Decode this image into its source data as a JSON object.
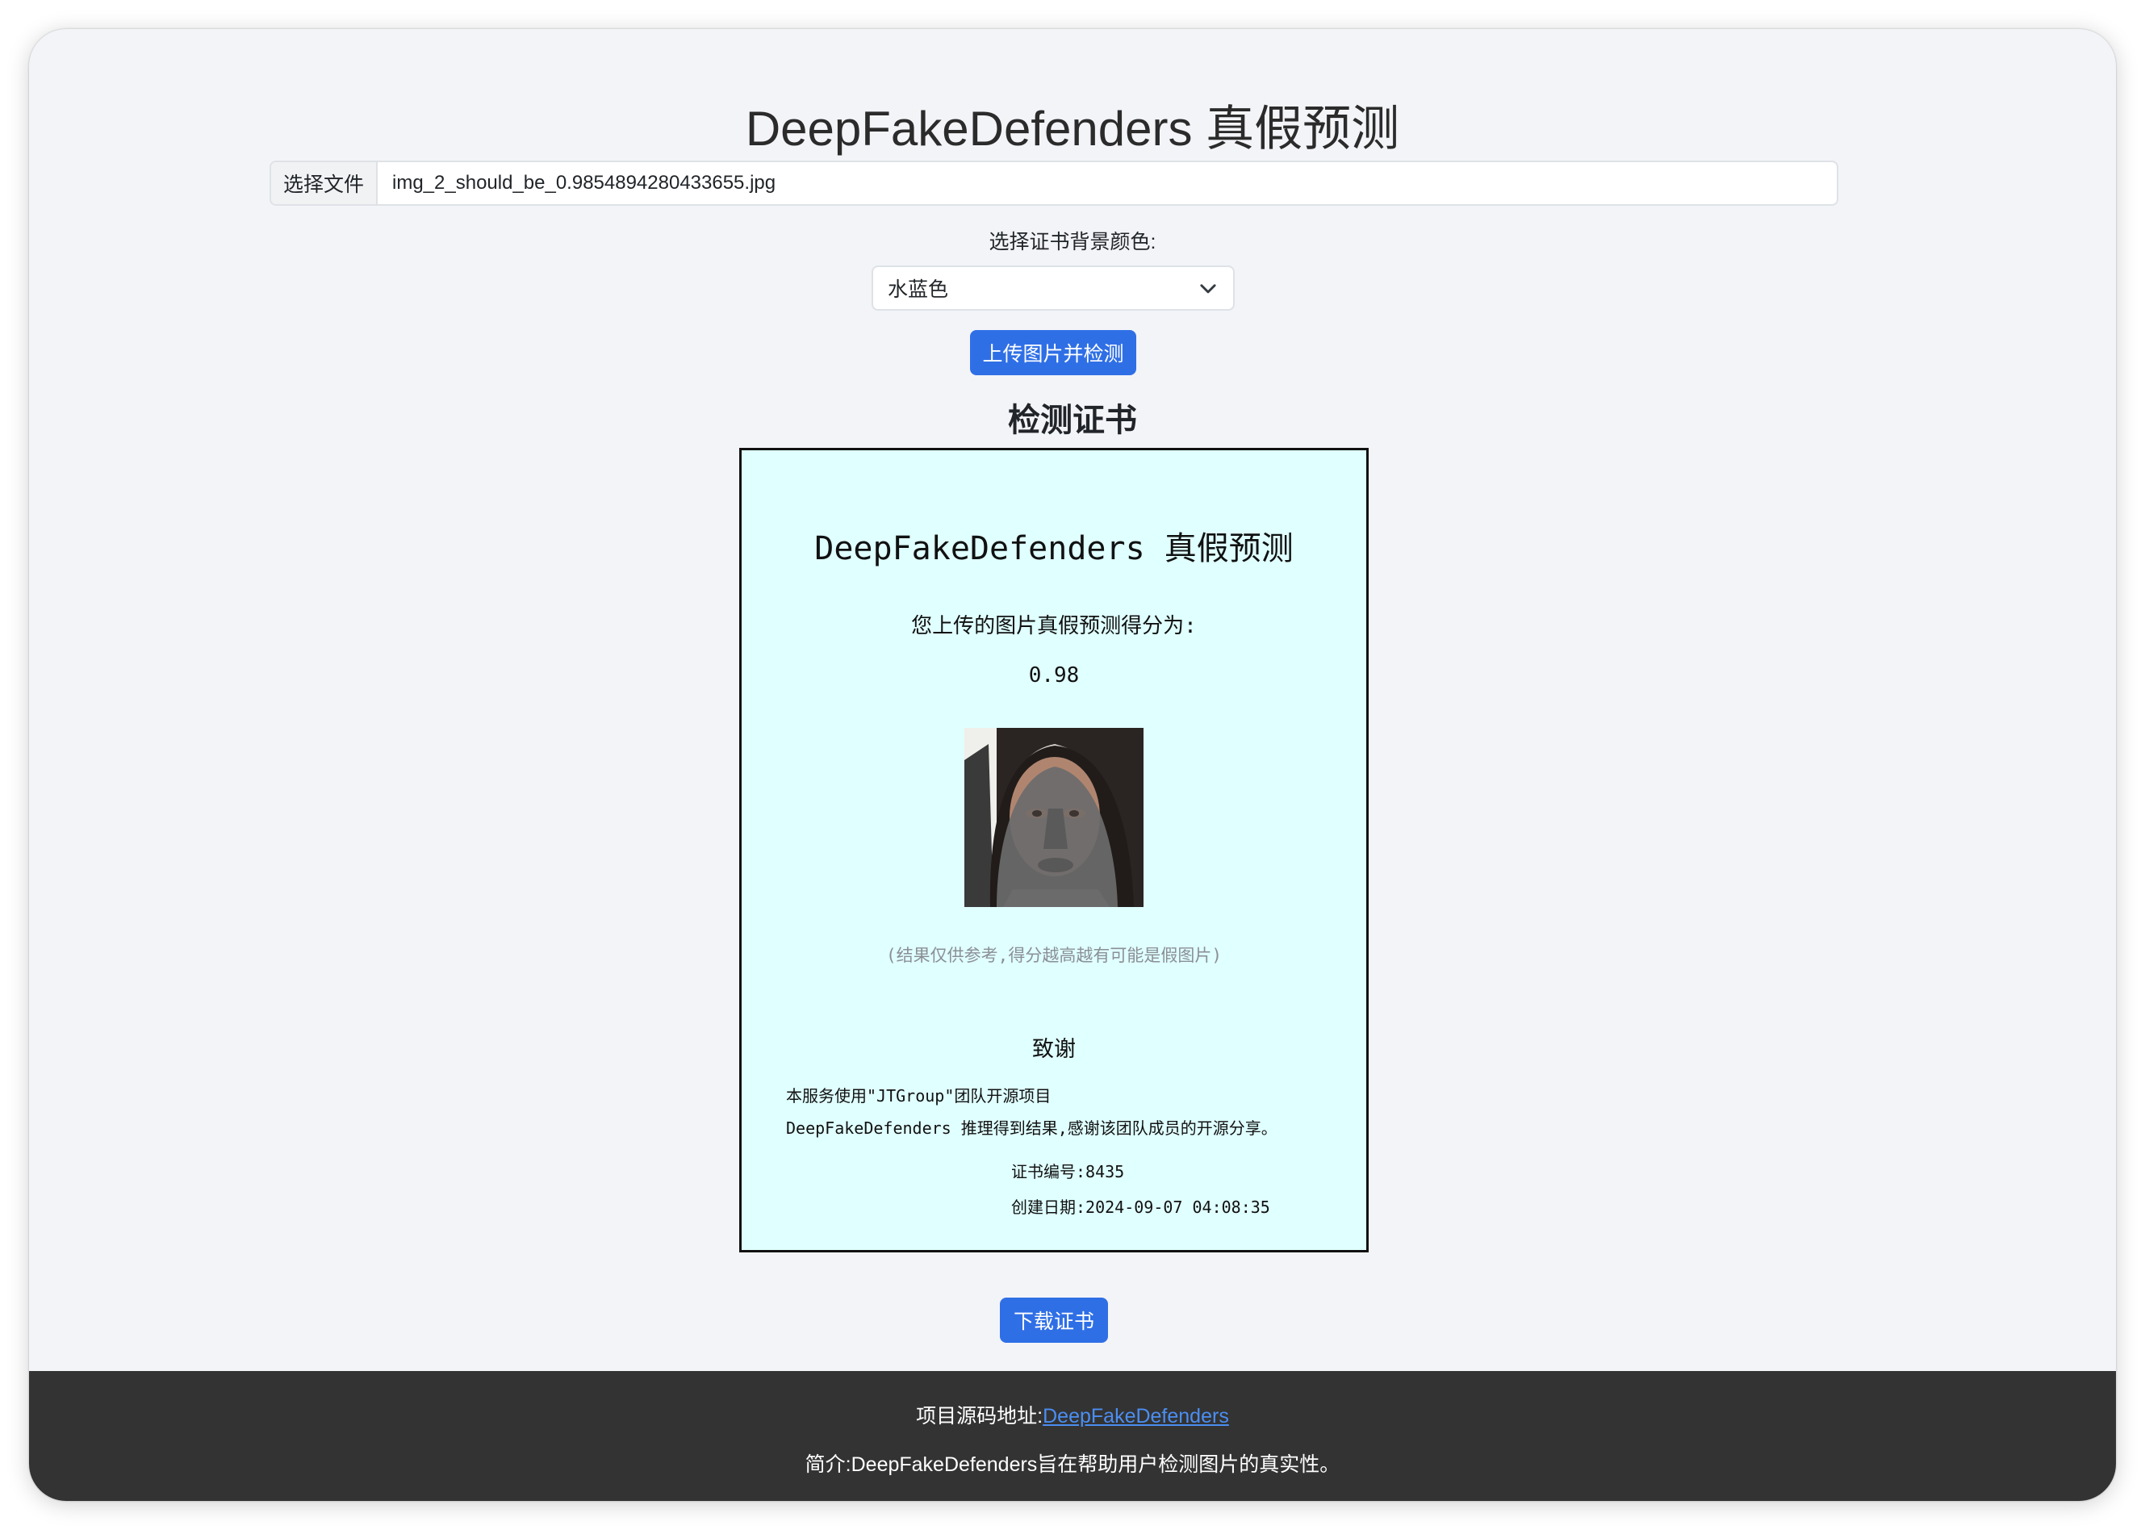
{
  "page": {
    "title": "DeepFakeDefenders 真假预测"
  },
  "upload": {
    "file_button_label": "选择文件",
    "file_name": "img_2_should_be_0.9854894280433655.jpg",
    "color_label": "选择证书背景颜色:",
    "color_selected": "水蓝色",
    "submit_label": "上传图片并检测"
  },
  "certificate": {
    "heading": "检测证书",
    "background_color": "#e0ffff",
    "title": "DeepFakeDefenders 真假预测",
    "subtitle": "您上传的图片真假预测得分为:",
    "score": "0.98",
    "note": "(结果仅供参考,得分越高越有可能是假图片)",
    "thanks_title": "致谢",
    "thanks_line1": "本服务使用\"JTGroup\"团队开源项目",
    "thanks_line2": "DeepFakeDefenders 推理得到结果,感谢该团队成员的开源分享。",
    "serial": "证书编号:8435",
    "created": "创建日期:2024-09-07 04:08:35",
    "download_label": "下载证书"
  },
  "footer": {
    "source_label": "项目源码地址:",
    "source_link": "DeepFakeDefenders",
    "intro": "简介:DeepFakeDefenders旨在帮助用户检测图片的真实性。"
  },
  "colors": {
    "accent": "#2f6fe6",
    "footer_bg": "#333333",
    "link": "#4b8ef2",
    "page_bg": "#f3f4f8"
  }
}
